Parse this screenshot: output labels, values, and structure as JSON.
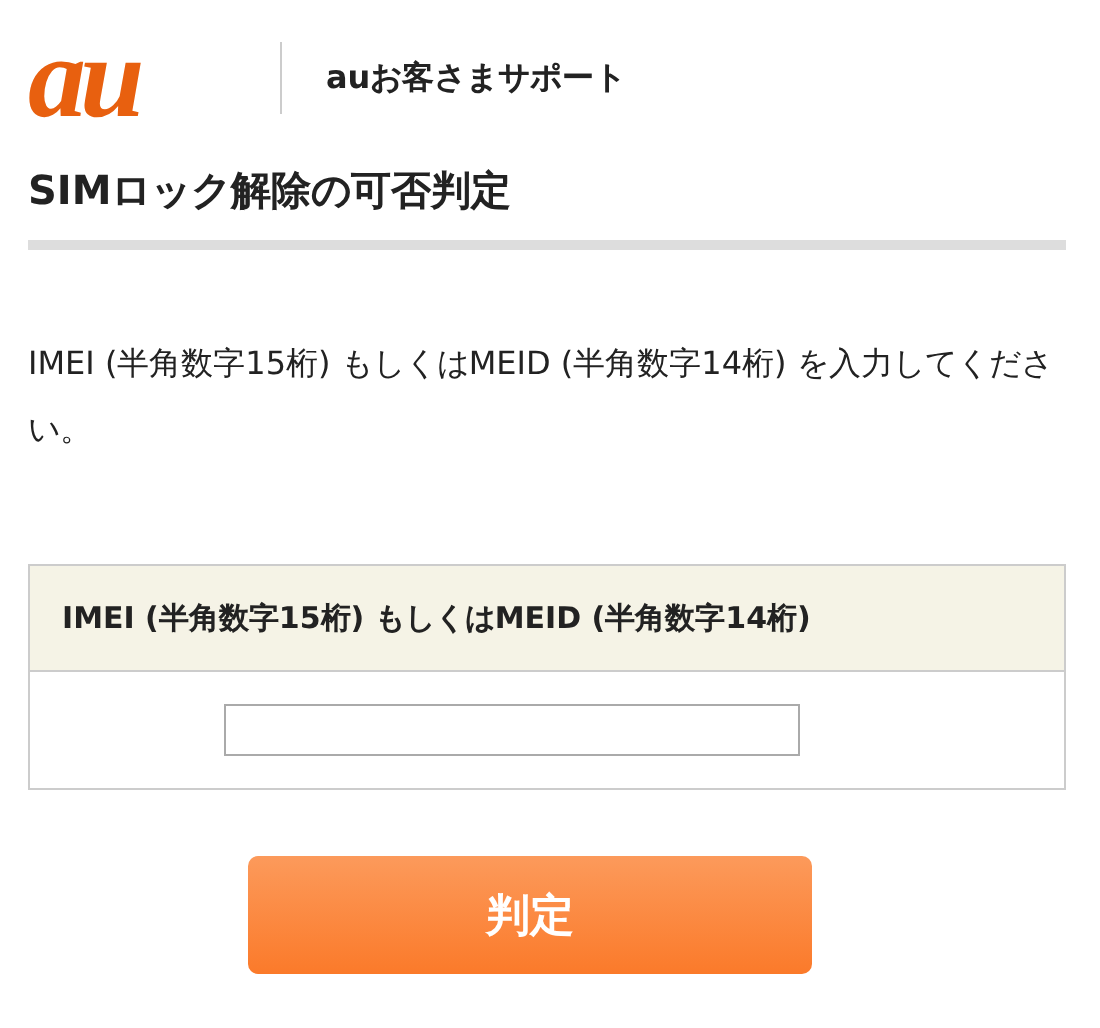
{
  "header": {
    "logo": "au",
    "site_title": "auお客さまサポート"
  },
  "page_title": "SIMロック解除の可否判定",
  "instruction": "IMEI (半角数字15桁) もしくはMEID (半角数字14桁) を入力してください。",
  "form": {
    "label": "IMEI (半角数字15桁) もしくはMEID (半角数字14桁)"
  },
  "submit_button": "判定"
}
